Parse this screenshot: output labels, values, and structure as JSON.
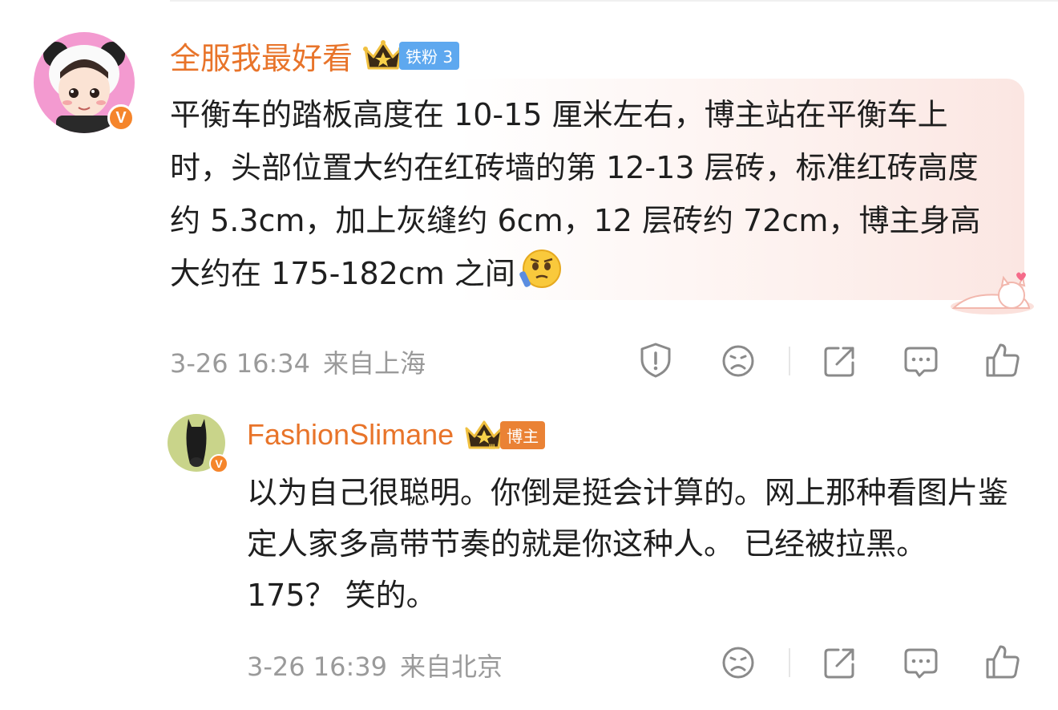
{
  "main_comment": {
    "username": "全服我最好看",
    "fan_badge": "铁粉 3",
    "text": "平衡车的踏板高度在 10-15 厘米左右，博主站在平衡车上时，头部位置大约在红砖墙的第 12-13 层砖，标准红砖高度约 5.3cm，加上灰缝约 6cm，12 层砖约 72cm，博主身高大约在 175-182cm 之间",
    "time": "3-26 16:34",
    "location": "来自上海",
    "icons": [
      "report-icon",
      "dislike-face-icon",
      "share-icon",
      "comment-icon",
      "like-icon"
    ]
  },
  "reply": {
    "username": "FashionSlimane",
    "role_badge": "博主",
    "text": "以为自己很聪明。你倒是挺会计算的。网上那种看图片鉴定人家多高带节奏的就是你这种人。 已经被拉黑。  175？  笑的。",
    "time": "3-26 16:39",
    "location": "来自北京",
    "icons": [
      "dislike-face-icon",
      "share-icon",
      "comment-icon",
      "like-icon"
    ]
  },
  "colors": {
    "username": "#e8742a",
    "fan_badge": "#5ea8ef",
    "blogger_badge": "#ea8235",
    "verified": "#f5852b",
    "meta_text": "#9a9a9a",
    "icon": "#8a8a8a"
  },
  "verified_mark": "V",
  "crown_rank": "III"
}
